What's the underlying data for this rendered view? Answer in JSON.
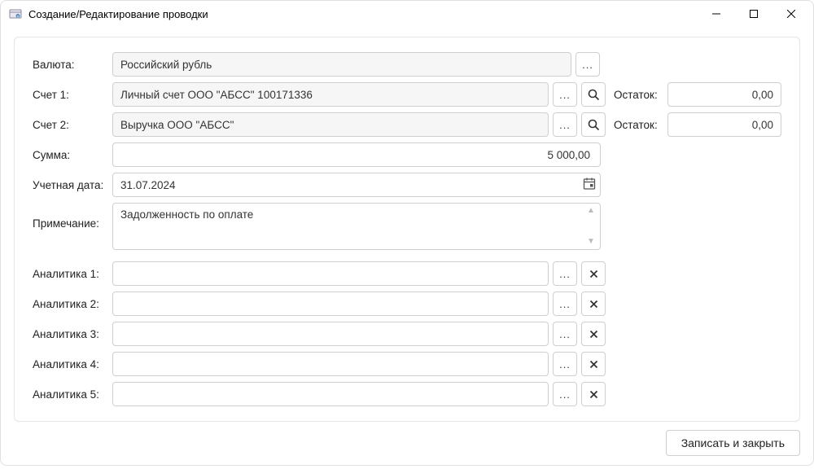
{
  "window": {
    "title": "Создание/Редактирование проводки"
  },
  "labels": {
    "currency": "Валюта:",
    "account1": "Счет 1:",
    "account2": "Счет 2:",
    "amount": "Сумма:",
    "date": "Учетная дата:",
    "note": "Примечание:",
    "analytic1": "Аналитика 1:",
    "analytic2": "Аналитика 2:",
    "analytic3": "Аналитика 3:",
    "analytic4": "Аналитика 4:",
    "analytic5": "Аналитика 5:",
    "balance": "Остаток:"
  },
  "values": {
    "currency": "Российский рубль",
    "account1": "Личный счет ООО \"АБСС\" 100171336",
    "account2": "Выручка ООО \"АБСС\"",
    "balance1": "0,00",
    "balance2": "0,00",
    "amount": "5 000,00",
    "date": "31.07.2024",
    "note": "Задолженность по оплате",
    "analytic1": "",
    "analytic2": "",
    "analytic3": "",
    "analytic4": "",
    "analytic5": ""
  },
  "buttons": {
    "ellipsis": "...",
    "clear": "✖",
    "save": "Записать и закрыть"
  }
}
